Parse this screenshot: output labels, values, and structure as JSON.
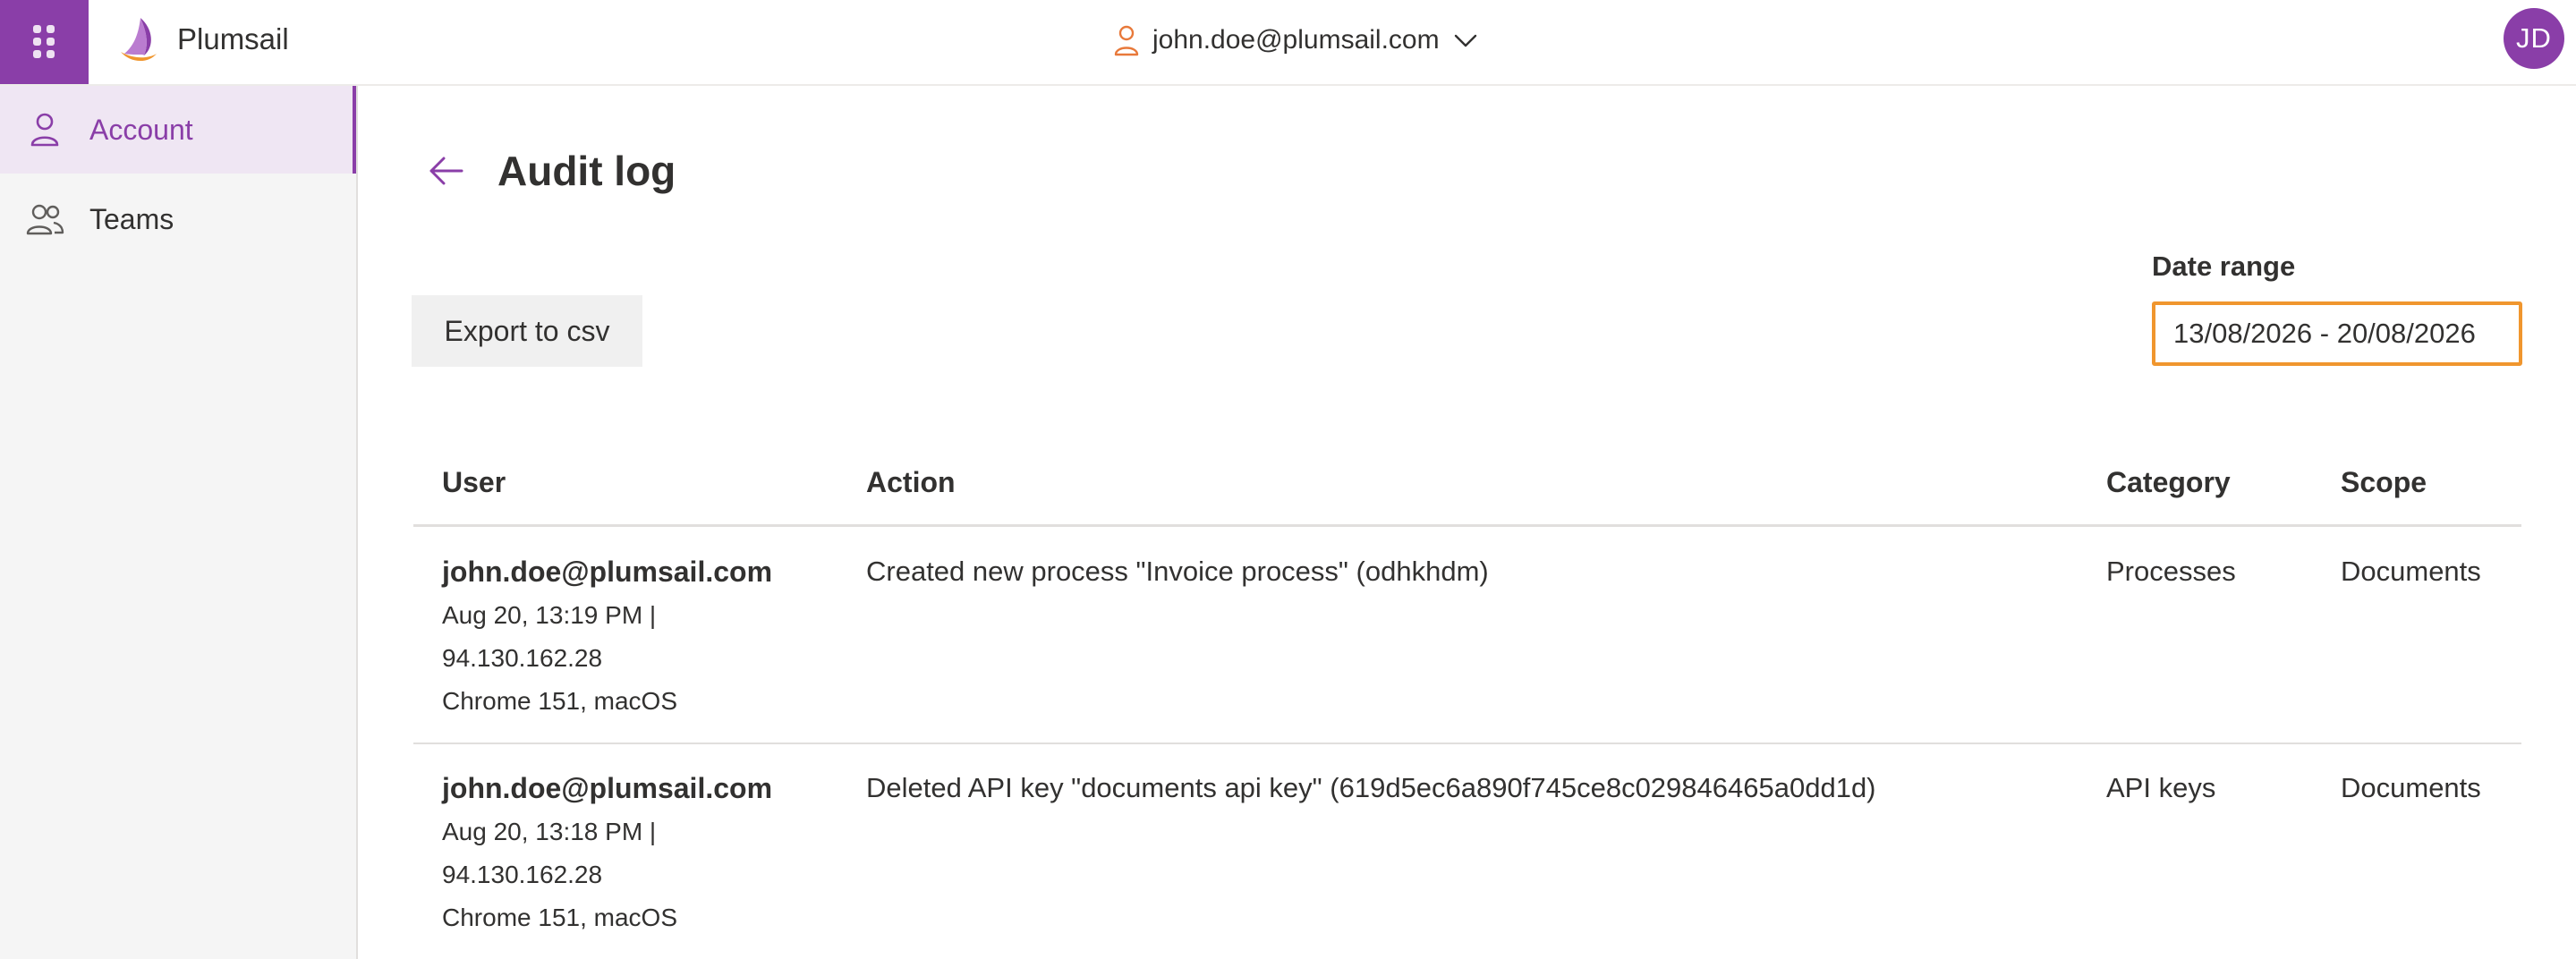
{
  "header": {
    "brand_name": "Plumsail",
    "user_email": "john.doe@plumsail.com",
    "avatar_initials": "JD",
    "accent_color": "#8a3ea8"
  },
  "sidebar": {
    "items": [
      {
        "label": "Account",
        "icon": "person-icon",
        "active": true
      },
      {
        "label": "Teams",
        "icon": "people-icon",
        "active": false
      }
    ]
  },
  "page": {
    "title": "Audit log",
    "export_label": "Export to csv",
    "date_range_label": "Date range",
    "date_range_value": "13/08/2026 - 20/08/2026",
    "highlight_color": "#f0962e"
  },
  "table": {
    "columns": [
      "User",
      "Action",
      "Category",
      "Scope"
    ],
    "rows": [
      {
        "user": "john.doe@plumsail.com",
        "time": "Aug 20, 13:19 PM |",
        "ip": "94.130.162.28",
        "agent": "Chrome 151, macOS",
        "action": "Created new process \"Invoice process\" (odhkhdm)",
        "category": "Processes",
        "scope": "Documents"
      },
      {
        "user": "john.doe@plumsail.com",
        "time": "Aug 20, 13:18 PM |",
        "ip": "94.130.162.28",
        "agent": "Chrome 151, macOS",
        "action": "Deleted API key \"documents api key\" (619d5ec6a890f745ce8c029846465a0dd1d)",
        "category": "API keys",
        "scope": "Documents"
      }
    ]
  }
}
